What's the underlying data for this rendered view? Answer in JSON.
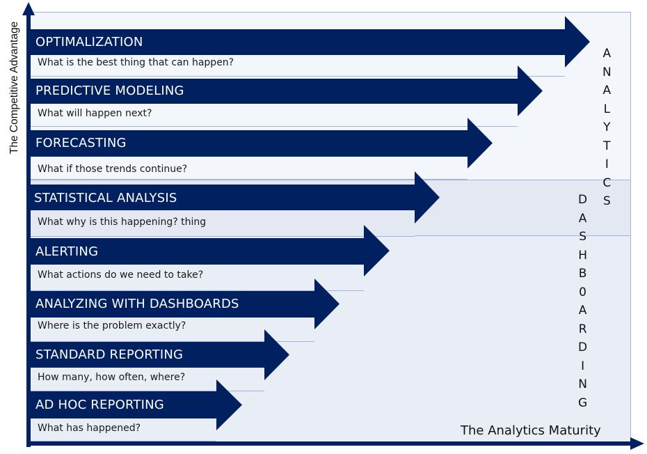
{
  "diagram": {
    "y_axis_label": "The Competitive Advantage",
    "x_axis_label": "The Analytics Maturity",
    "side_labels": {
      "analytics": [
        "A",
        "N",
        "A",
        "L",
        "Y",
        "T",
        "I",
        "C",
        "S"
      ],
      "dashboarding": [
        "D",
        "A",
        "S",
        "H",
        "B",
        "0",
        "A",
        "R",
        "D",
        "I",
        "N",
        "G"
      ]
    },
    "stages": [
      {
        "title": "OPTIMALIZATION",
        "question": "What is the best thing that can happen?"
      },
      {
        "title": "PREDICTIVE MODELING",
        "question": "What will happen next?"
      },
      {
        "title": "FORECASTING",
        "question": "What if those trends continue?"
      },
      {
        "title": "STATISTICAL ANALYSIS",
        "question": "What why is this happening?  thing"
      },
      {
        "title": "ALERTING",
        "question": "What actions do we need to take?"
      },
      {
        "title": "ANALYZING WITH DASHBOARDS",
        "question": "Where is the problem exactly?"
      },
      {
        "title": "STANDARD REPORTING",
        "question": "How many, how often, where?"
      },
      {
        "title": "AD HOC REPORTING",
        "question": "What has happened?"
      }
    ],
    "colors": {
      "arrow": "#002060",
      "band_top": "#f3f6fb",
      "band_mid": "#e3e8f3",
      "band_bottom": "#e9edf6",
      "border": "#9db4df"
    }
  }
}
